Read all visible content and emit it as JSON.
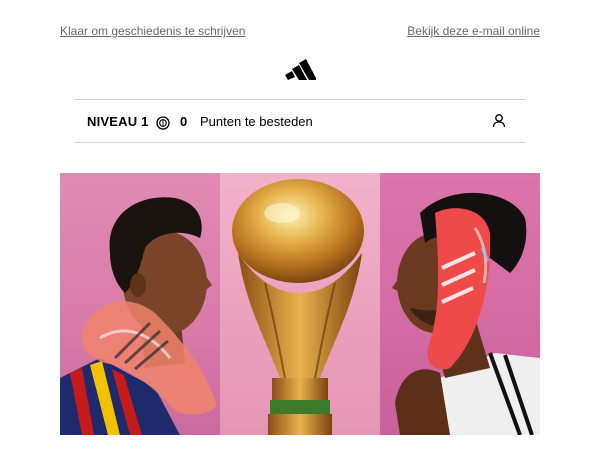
{
  "header": {
    "left_link": "Klaar om geschiedenis te schrijven",
    "right_link": "Bekijk deze e-mail online"
  },
  "brand": {
    "logo_icon": "adidas-logo-icon"
  },
  "rewards": {
    "level_label": "NIVEAU 1",
    "points_icon": "points-coin-icon",
    "points_value": "0",
    "points_label": "Punten te besteden",
    "account_icon": "user-icon"
  },
  "hero": {
    "panels": [
      "player-with-boot-left",
      "world-cup-trophy",
      "player-with-boot-right"
    ]
  },
  "colors": {
    "link_gray": "#6b6b6b",
    "divider": "#d2d2d2",
    "hero_pink": "#d97aa8"
  }
}
